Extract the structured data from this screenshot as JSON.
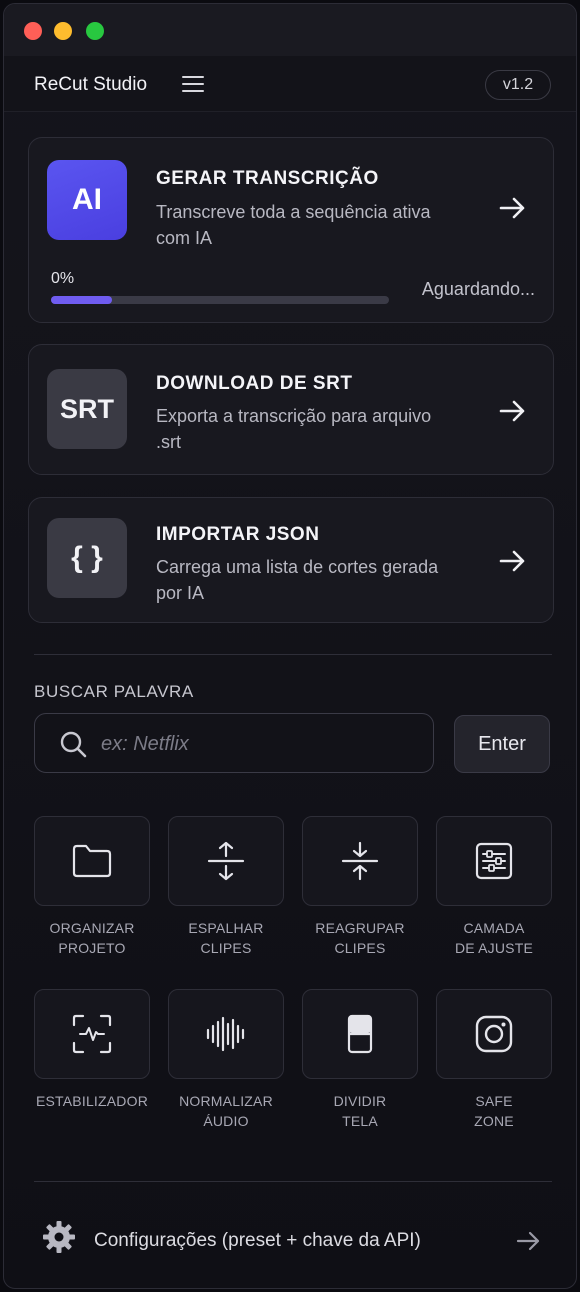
{
  "app": {
    "title": "ReCut Studio",
    "version": "v1.2"
  },
  "cards": [
    {
      "icon_text": "AI",
      "icon_name": "ai-icon",
      "title": "GERAR TRANSCRIÇÃO",
      "description": "Transcreve toda a sequência ativa com IA",
      "progress": {
        "percent_label": "0%",
        "status": "Aguardando...",
        "fill_fraction": 0.18
      }
    },
    {
      "icon_text": "SRT",
      "icon_name": "srt-icon",
      "title": "DOWNLOAD DE SRT",
      "description": "Exporta a transcrição para arquivo .srt"
    },
    {
      "icon_text": "{ }",
      "icon_name": "json-braces-icon",
      "title": "IMPORTAR JSON",
      "description": "Carrega uma lista de cortes gerada por IA"
    }
  ],
  "search": {
    "section_label": "BUSCAR PALAVRA",
    "placeholder": "ex: Netflix",
    "value": "",
    "enter_label": "Enter"
  },
  "tools": [
    {
      "label": "ORGANIZAR\nPROJETO",
      "icon": "folder-icon"
    },
    {
      "label": "ESPALHAR\nCLIPES",
      "icon": "expand-vertical-icon"
    },
    {
      "label": "REAGRUPAR\nCLIPES",
      "icon": "collapse-vertical-icon"
    },
    {
      "label": "CAMADA\nDE AJUSTE",
      "icon": "sliders-icon"
    },
    {
      "label": "ESTABILIZADOR",
      "icon": "stabilizer-icon"
    },
    {
      "label": "NORMALIZAR\nÁUDIO",
      "icon": "audio-waveform-icon"
    },
    {
      "label": "DIVIDIR\nTELA",
      "icon": "split-screen-icon"
    },
    {
      "label": "SAFE\nZONE",
      "icon": "safe-zone-icon"
    }
  ],
  "settings": {
    "label": "Configurações (preset + chave da API)"
  },
  "colors": {
    "accent": "#6f5cf0",
    "ai_icon_bg": "#5a55f0",
    "background": "#0f0f15"
  }
}
